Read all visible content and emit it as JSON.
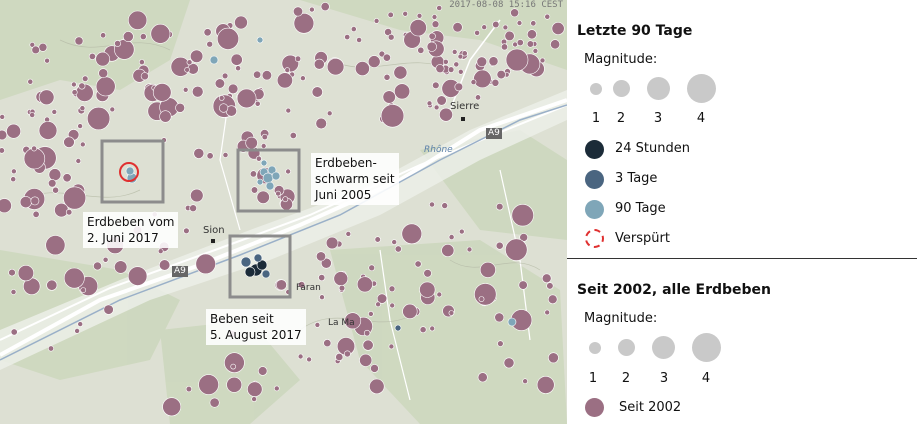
{
  "map": {
    "timestamp": "2017-08-08 15:16 CEST",
    "callouts": {
      "erdbeben_2_juni": [
        "Erdbeben vom",
        "2. Juni 2017"
      ],
      "schwarm": [
        "Erdbeben-",
        "schwarm seit",
        "Juni 2005"
      ],
      "beben_august": [
        "Beben seit",
        "5. August 2017"
      ]
    },
    "places": {
      "sierre": "Sierre",
      "sion": "Sion",
      "rhone": "Rhône",
      "faran": "Faran",
      "la_ma": "La Ma"
    },
    "roads": {
      "a9_east": "A9",
      "a9_west": "A9"
    }
  },
  "legend": {
    "recent": {
      "title": "Letzte 90 Tage",
      "magnitude_label": "Magnitude:",
      "magnitudes": [
        "1",
        "2",
        "3",
        "4"
      ],
      "categories": [
        {
          "label": "24 Stunden",
          "color": "#1b2b38"
        },
        {
          "label": "3 Tage",
          "color": "#4a6580"
        },
        {
          "label": "90 Tage",
          "color": "#7fa6b8"
        },
        {
          "label": "Verspürt",
          "color": "#e03030"
        }
      ]
    },
    "since2002": {
      "title": "Seit 2002, alle Erdbeben",
      "magnitude_label": "Magnitude:",
      "magnitudes": [
        "1",
        "2",
        "3",
        "4"
      ],
      "category": {
        "label": "Seit 2002",
        "color": "#9b6f83"
      }
    }
  },
  "colors": {
    "quake_old": "#9b6f83",
    "quake_old_stroke": "#ffffff",
    "mag_grey": "#c9c9c9",
    "felt_ring": "#e03030",
    "box": "#8c8c8c"
  }
}
